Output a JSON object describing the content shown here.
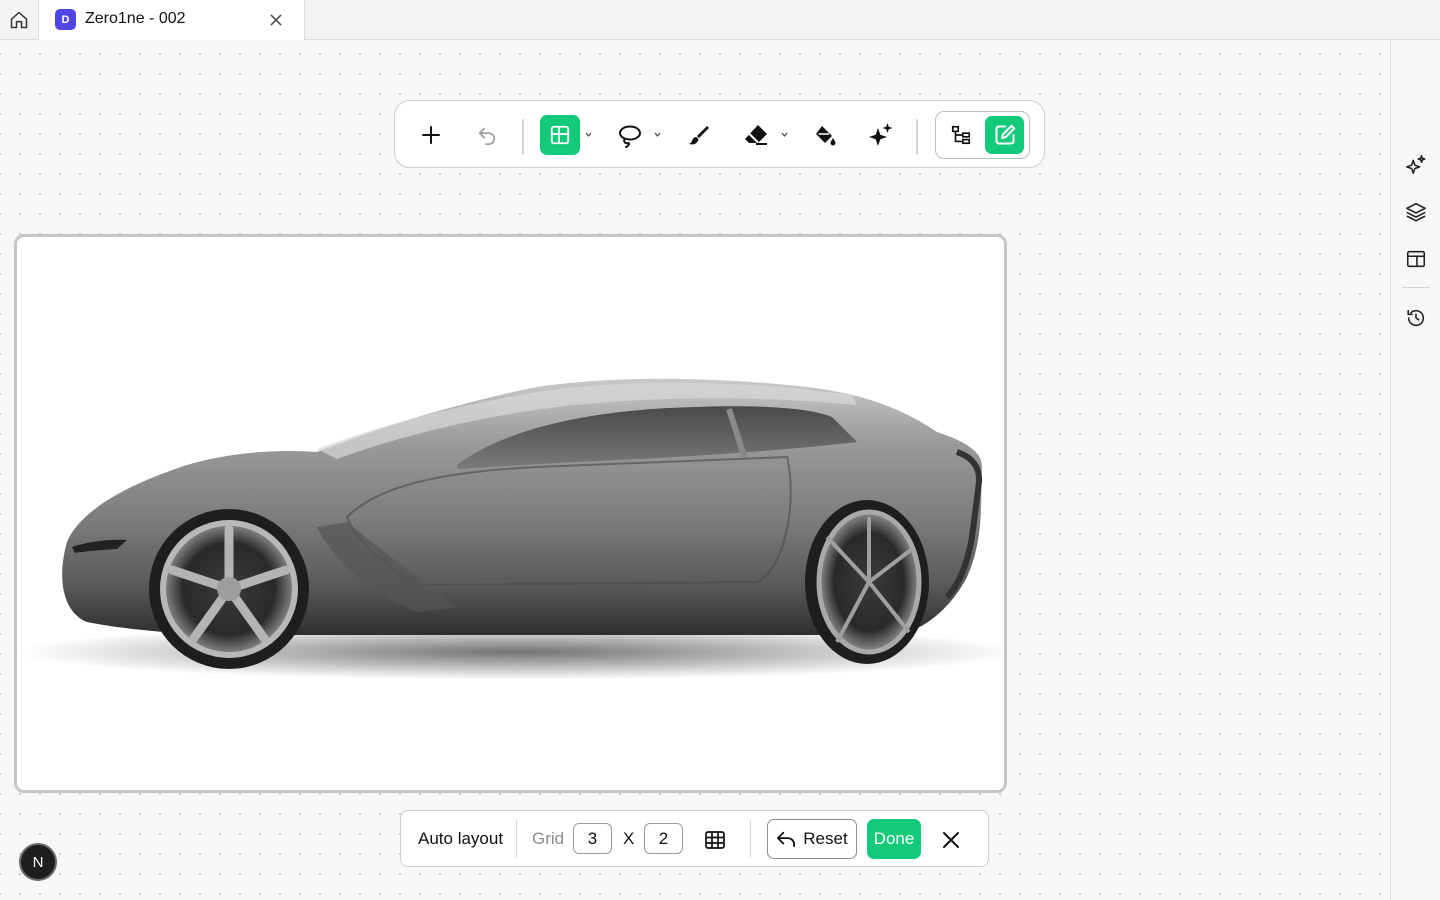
{
  "tab": {
    "badge": "D",
    "title": "Zero1ne - 002"
  },
  "icons": {
    "home": "home-icon",
    "close": "close-icon",
    "add": "plus-icon",
    "undo": "undo-icon",
    "grid": "grid-select-icon",
    "lasso": "lasso-icon",
    "brush": "brush-icon",
    "eraser": "eraser-icon",
    "fill": "paint-bucket-icon",
    "ai": "sparkle-icon",
    "hierarchy": "hierarchy-icon",
    "edit": "edit-icon",
    "panel": [
      "ai-sparkle-icon",
      "layers-icon",
      "layout-icon",
      "history-icon"
    ]
  },
  "colors": {
    "accent": "#13c97a",
    "tab_badge": "#4f46e5"
  },
  "bottombar": {
    "auto_layout": "Auto layout",
    "grid_label": "Grid",
    "cols": "3",
    "times": "X",
    "rows": "2",
    "reset": "Reset",
    "done": "Done"
  },
  "user": {
    "initial": "N"
  }
}
